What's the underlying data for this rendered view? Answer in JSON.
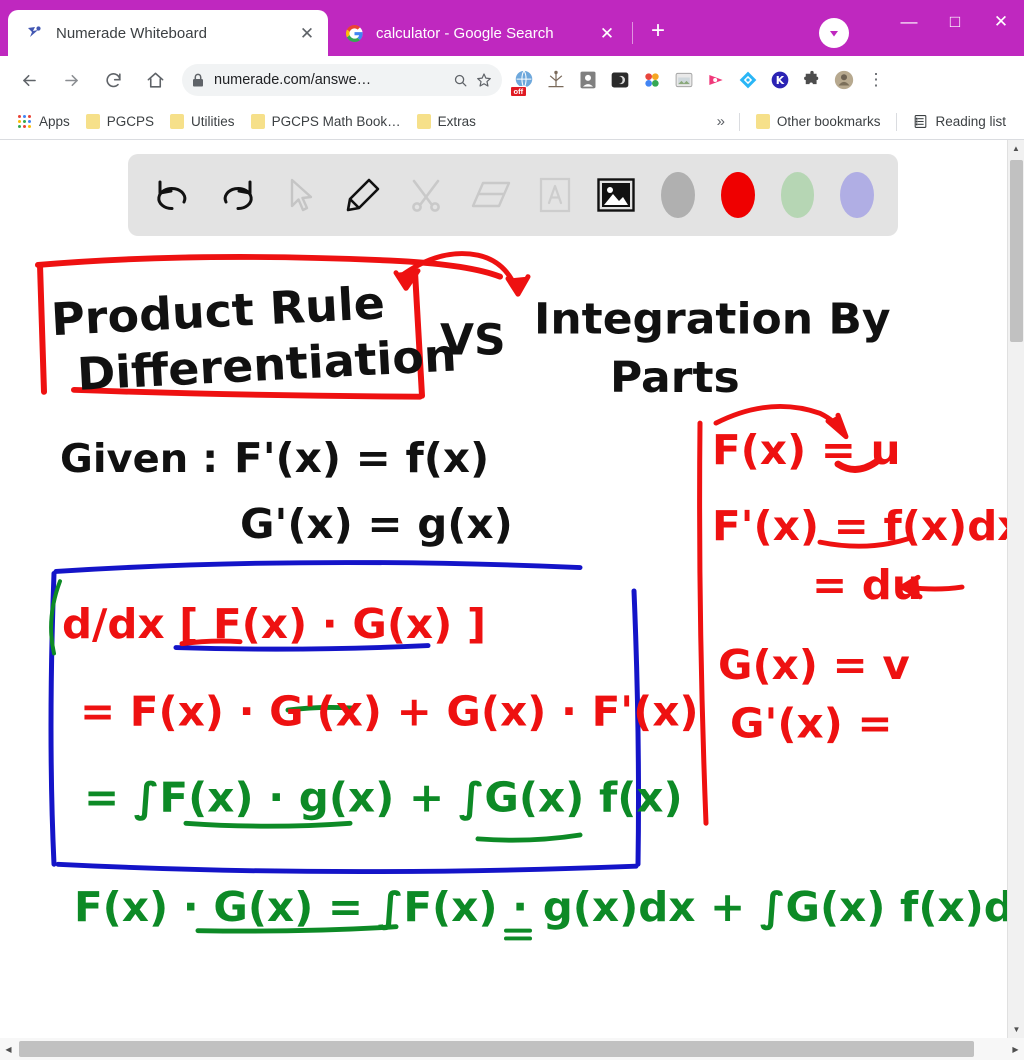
{
  "window": {
    "theme_color": "#bf28bf",
    "controls": {
      "minimize": "—",
      "maximize": "□",
      "close": "✕"
    },
    "profile_avatar_name": "profile-avatar"
  },
  "tabs": [
    {
      "title": "Numerade Whiteboard",
      "favicon": "numerade-icon",
      "active": true,
      "close_label": "✕"
    },
    {
      "title": "calculator - Google Search",
      "favicon": "google-icon",
      "active": false,
      "close_label": "✕"
    }
  ],
  "newtab_label": "+",
  "navigation": {
    "back_label": "←",
    "forward_label": "→",
    "reload_label": "↻",
    "home_label": "⌂"
  },
  "omnibox": {
    "url": "numerade.com/answe…",
    "lock_icon": "lock-icon",
    "search_icon": "search-icon",
    "bookmark_icon": "star-icon"
  },
  "extensions": [
    {
      "name": "adblock-off-icon",
      "glyph": "🌐",
      "badge": "off",
      "badge_color": "#e01b24"
    },
    {
      "name": "antenna-icon",
      "glyph": "⑂",
      "badge": "",
      "badge_color": ""
    },
    {
      "name": "screen-capture-icon",
      "glyph": "▣",
      "badge": "",
      "badge_color": ""
    },
    {
      "name": "dark-reader-icon",
      "glyph": "◐",
      "badge": "",
      "badge_color": ""
    },
    {
      "name": "four-dots-icon",
      "glyph": "∷",
      "badge": "",
      "badge_color": ""
    },
    {
      "name": "window-capture-icon",
      "glyph": "❐",
      "badge": "",
      "badge_color": ""
    },
    {
      "name": "play-arrow-icon",
      "glyph": "▶",
      "badge": "",
      "badge_color": ""
    },
    {
      "name": "diamond-icon",
      "glyph": "◇",
      "badge": "",
      "badge_color": ""
    },
    {
      "name": "kami-k-icon",
      "glyph": "K",
      "badge": "",
      "badge_color": ""
    },
    {
      "name": "puzzle-piece-icon",
      "glyph": "❖",
      "badge": "",
      "badge_color": ""
    },
    {
      "name": "user-avatar-icon",
      "glyph": "●",
      "badge": "",
      "badge_color": ""
    }
  ],
  "browser_menu_label": "⋮",
  "bookmarks": {
    "apps_label": "Apps",
    "items": [
      {
        "label": "PGCPS"
      },
      {
        "label": "Utilities"
      },
      {
        "label": "PGCPS Math Book…"
      },
      {
        "label": "Extras"
      }
    ],
    "overflow_label": "»",
    "other_label": "Other bookmarks",
    "reading_list_label": "Reading list"
  },
  "whiteboard": {
    "toolbar": [
      {
        "name": "undo-icon",
        "label": "Undo",
        "enabled": true
      },
      {
        "name": "redo-icon",
        "label": "Redo",
        "enabled": true
      },
      {
        "name": "pointer-icon",
        "label": "Select",
        "enabled": false
      },
      {
        "name": "pencil-icon",
        "label": "Pen",
        "enabled": true
      },
      {
        "name": "shapes-tools-icon",
        "label": "Tools",
        "enabled": false
      },
      {
        "name": "eraser-icon",
        "label": "Eraser",
        "enabled": false
      },
      {
        "name": "text-icon",
        "label": "Text",
        "enabled": false
      },
      {
        "name": "image-icon",
        "label": "Insert image",
        "enabled": true
      }
    ],
    "swatches": [
      {
        "name": "color-swatch-grey",
        "color": "#b0b0b0"
      },
      {
        "name": "color-swatch-red",
        "color": "#ef0000"
      },
      {
        "name": "color-swatch-green",
        "color": "#b6d6b4"
      },
      {
        "name": "color-swatch-purple",
        "color": "#b0aee4"
      }
    ],
    "colors": {
      "black": "#111111",
      "red": "#ee1111",
      "blue": "#1414c8",
      "green": "#0d8a26"
    },
    "notes": {
      "title_left_line1": "Product Rule",
      "title_left_line2": "Differentiation",
      "vs": "VS",
      "title_right_line1": "Integration  By",
      "title_right_line2": "Parts",
      "given_label": "Given :",
      "given_line1": "F'(x)  =  f(x)",
      "given_line2": "G'(x)  =  g(x)",
      "boxed_line1": "d/dx [ F(x) · G(x) ]",
      "boxed_line2": "= F(x) · G'(x) + G(x) · F'(x)",
      "boxed_line3": "= ∫F(x) · g(x) + ∫G(x) f(x)",
      "final_line": "F(x) · G(x) = ∫F(x) · g(x)dx + ∫G(x) f(x)dx",
      "right_line1": "F(x) =  u",
      "right_line2": "F'(x) = f(x)dx",
      "right_line3": "= du",
      "right_line4": "G(x) = v",
      "right_line5": "G'(x) ="
    }
  },
  "scrollbars": {
    "vertical_up": "▲",
    "vertical_down": "▼",
    "horizontal_left": "◀",
    "horizontal_right": "▶"
  }
}
